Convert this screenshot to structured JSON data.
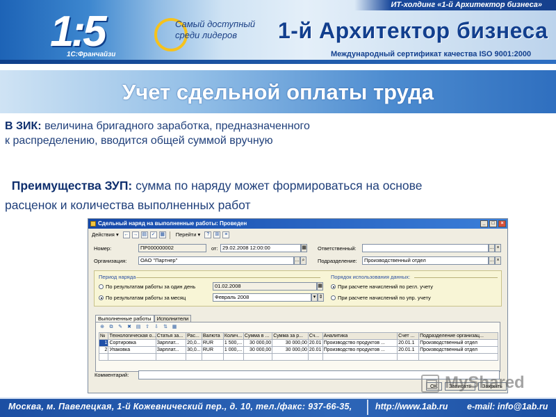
{
  "header": {
    "top_bar": "ИТ-холдинг «1-й Архитектор бизнеса»",
    "logo": "1:5",
    "franchise": "1С:Франчайзи",
    "slogan_line1": "Самый доступный",
    "slogan_line2": "среди лидеров",
    "brand": "1-й Архитектор бизнеса",
    "certificate": "Международный сертификат качества ISO 9001:2000"
  },
  "slide": {
    "title": "Учет сдельной оплаты труда",
    "para1_bold": "В ЗИК:",
    "para1_text": " величина бригадного заработка, предназначенного",
    "para1_line2": "к распределению,  вводится общей суммой вручную",
    "para2_bold": "Преимущества ЗУП:",
    "para2_text": " сумма по наряду может формироваться на основе",
    "para2_line2": "расценок и количества выполненных работ"
  },
  "window": {
    "title": "Сдельный наряд на выполненные работы: Проведен",
    "toolbar": {
      "actions": "Действия ▾",
      "goto": "Перейти ▾",
      "help": "?"
    },
    "number_label": "Номер:",
    "number_value": "ПР000000002",
    "date_label": "от:",
    "date_value": "29.02.2008 12:00:00",
    "responsible_label": "Ответственный:",
    "responsible_value": "",
    "org_label": "Организация:",
    "org_value": "ОАО \"Партнер\"",
    "dept_label": "Подразделение:",
    "dept_value": "Производственный отдел",
    "period_group": "Период наряда",
    "period_opt1": "По результатам работы за один день",
    "period_opt1_value": "01.02.2008",
    "period_opt2": "По результатам работы за месяц",
    "period_opt2_value": "Февраль 2008",
    "usage_group": "Порядок использования данных:",
    "usage_opt1": "При расчете начислений по регл. учету",
    "usage_opt2": "При расчете начислений по упр. учету",
    "tabs": [
      "Выполненные работы",
      "Исполнители"
    ],
    "columns": [
      "№",
      "Технологическая о...",
      "Статья за...",
      "Рас...",
      "Валюта",
      "Колич...",
      "Сумма в ...",
      "Сумма за р...",
      "Сч...",
      "Аналитика",
      "Счет ...",
      "Подразделение организац..."
    ],
    "rows": [
      [
        "1",
        "Сортировка",
        "Зарплат...",
        "20,0...",
        "RUR",
        "1 500,...",
        "30 000,00",
        "30 000,00",
        "20.01",
        "Производство продуктов ...",
        "20.01.1",
        "Производственный отдел"
      ],
      [
        "2",
        "Упаковка",
        "Зарплат...",
        "30,0...",
        "RUR",
        "1 000,...",
        "30 000,00",
        "30 000,00",
        "20.01",
        "Производство продуктов ...",
        "20.01.1",
        "Производственный отдел"
      ]
    ],
    "comment_label": "Комментарий:",
    "comment_value": "",
    "buttons": {
      "ok": "OK",
      "save": "Записать",
      "close": "Закрыть"
    }
  },
  "watermark": "MyShared",
  "footer": {
    "address": "Москва, м. Павелецкая, 1-й Кожевнический  пер., д. 10, тел./факс: 937-66-35,",
    "web": "http://www.1ab.ru",
    "email": "e-mail: info@1ab.ru"
  }
}
